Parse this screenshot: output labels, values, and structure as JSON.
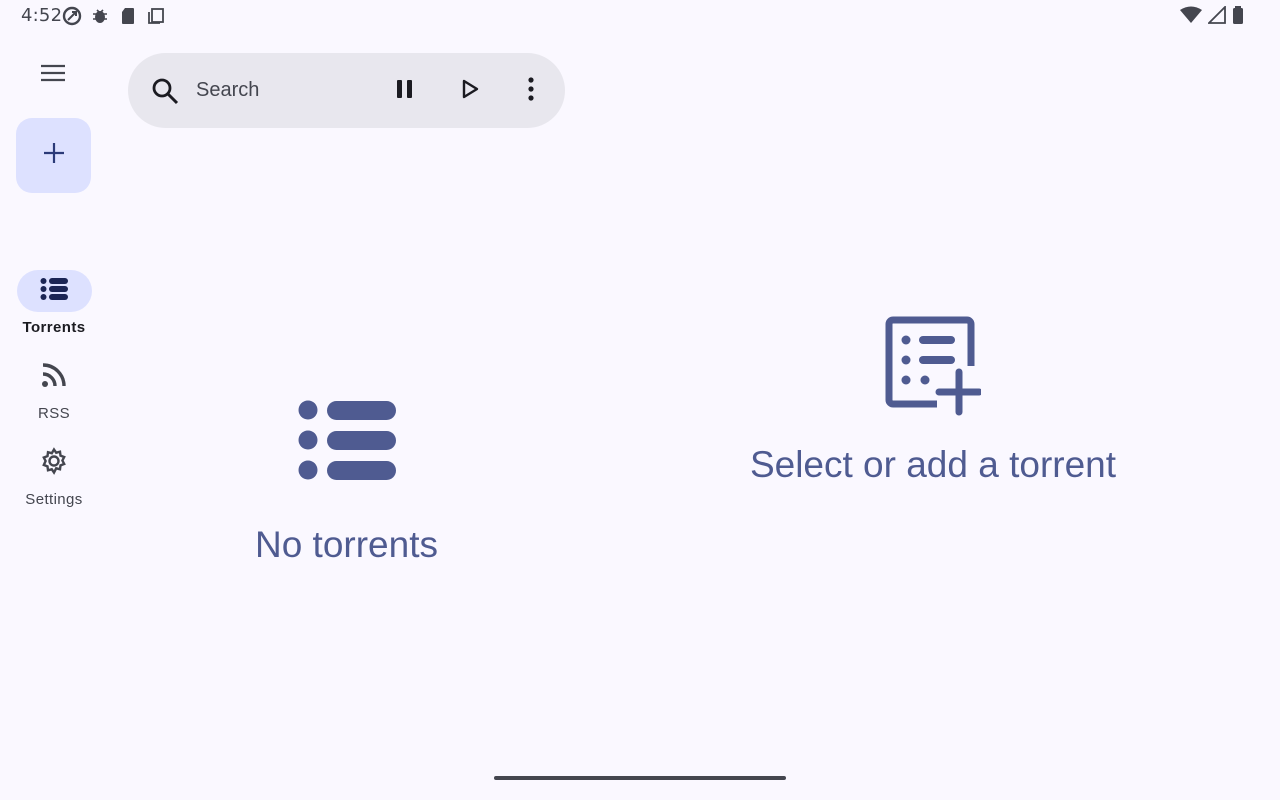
{
  "status_bar": {
    "time": "4:52",
    "left_icons": [
      "data-saver-icon",
      "bug-icon",
      "sd-card-icon",
      "copy-icon"
    ],
    "right_icons": [
      "wifi-icon",
      "cell-signal-icon",
      "battery-icon"
    ]
  },
  "rail": {
    "menu_icon": "menu-icon",
    "fab_icon": "add-icon",
    "items": [
      {
        "label": "Torrents",
        "icon": "list-icon",
        "active": true
      },
      {
        "label": "RSS",
        "icon": "rss-icon",
        "active": false
      },
      {
        "label": "Settings",
        "icon": "gear-icon",
        "active": false
      }
    ]
  },
  "search": {
    "placeholder": "Search",
    "value": "",
    "actions": [
      "pause-icon",
      "play-icon",
      "more-vert-icon"
    ]
  },
  "list_pane": {
    "empty_icon": "list-icon",
    "empty_text": "No torrents"
  },
  "detail_pane": {
    "empty_icon": "playlist-add-icon",
    "empty_text": "Select or add a torrent"
  },
  "colors": {
    "background": "#faf8ff",
    "accent": "#4f5b91",
    "container": "#dde1ff",
    "search_bg": "#e8e7ee"
  }
}
